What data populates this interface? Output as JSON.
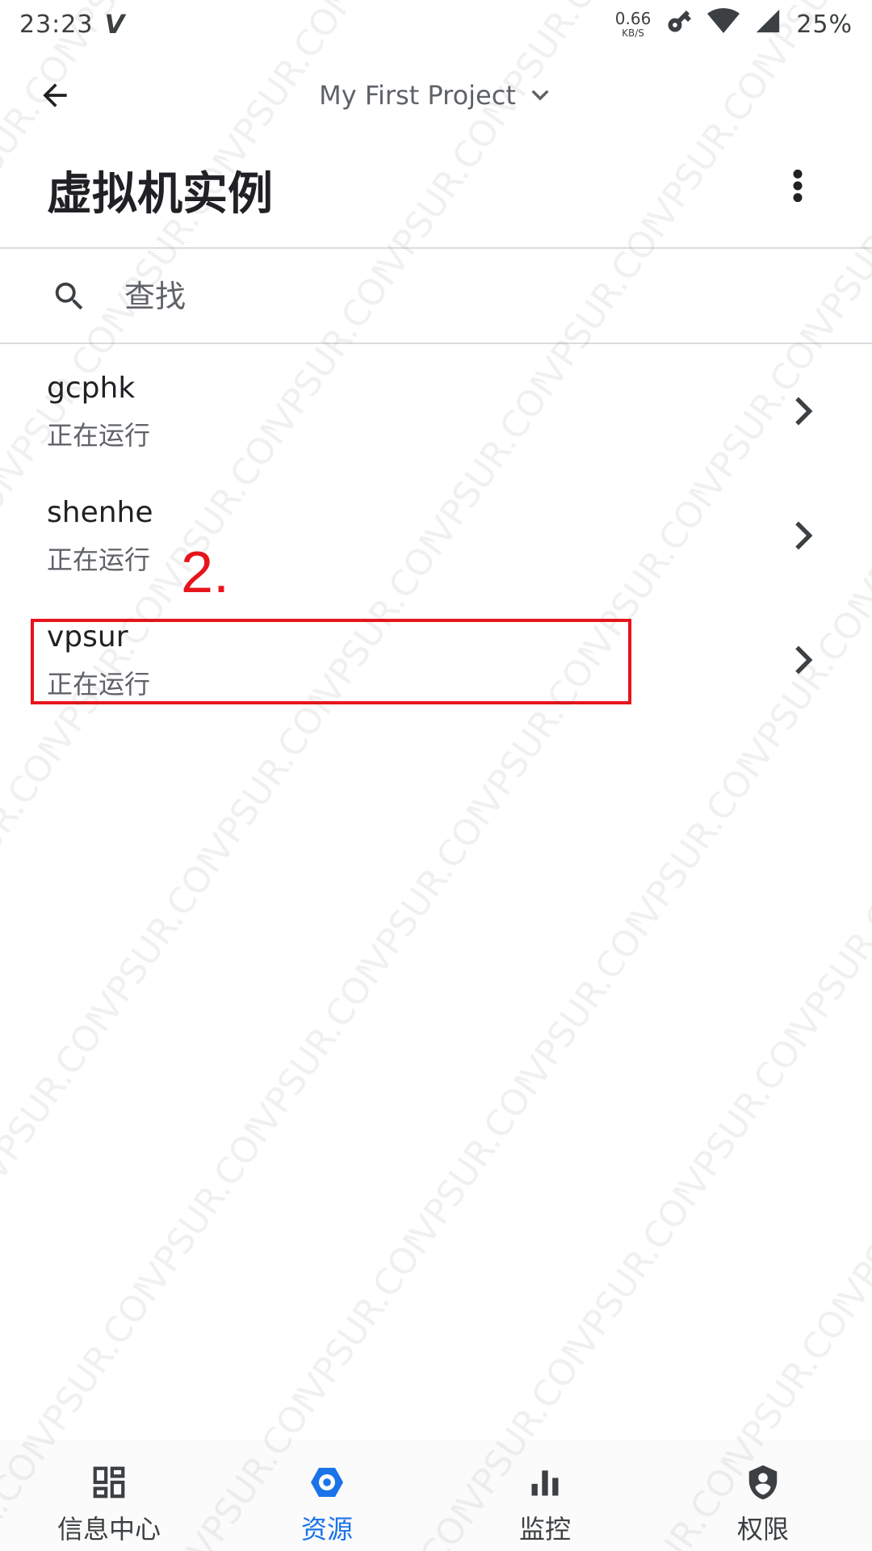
{
  "status_bar": {
    "time": "23:23",
    "carrier_glyph": "V",
    "net_speed_value": "0.66",
    "net_speed_unit": "KB/S",
    "battery": "25%",
    "icons": [
      "key-icon",
      "wifi-icon",
      "signal-icon"
    ]
  },
  "app_bar": {
    "project_name": "My First Project",
    "back_icon": "arrow-back-icon",
    "dropdown_icon": "chevron-down-icon"
  },
  "page": {
    "title": "虚拟机实例",
    "more_icon": "more-vert-icon"
  },
  "search": {
    "placeholder": "查找",
    "value": ""
  },
  "instances": [
    {
      "name": "gcphk",
      "status": "正在运行"
    },
    {
      "name": "shenhe",
      "status": "正在运行"
    },
    {
      "name": "vpsur",
      "status": "正在运行"
    }
  ],
  "annotation": {
    "step_label": "2.",
    "color": "#e8141b"
  },
  "watermark_text": "VPSUR.COM",
  "bottom_nav": {
    "items": [
      {
        "label": "信息中心",
        "icon": "dashboard-icon",
        "active": false
      },
      {
        "label": "资源",
        "icon": "cloud-hexagon-icon",
        "active": true
      },
      {
        "label": "监控",
        "icon": "bar-chart-icon",
        "active": false
      },
      {
        "label": "权限",
        "icon": "shield-person-icon",
        "active": false
      }
    ]
  },
  "colors": {
    "accent": "#1a73e8",
    "text_primary": "#202124",
    "text_secondary": "#5f6368",
    "divider": "#dadce0"
  }
}
